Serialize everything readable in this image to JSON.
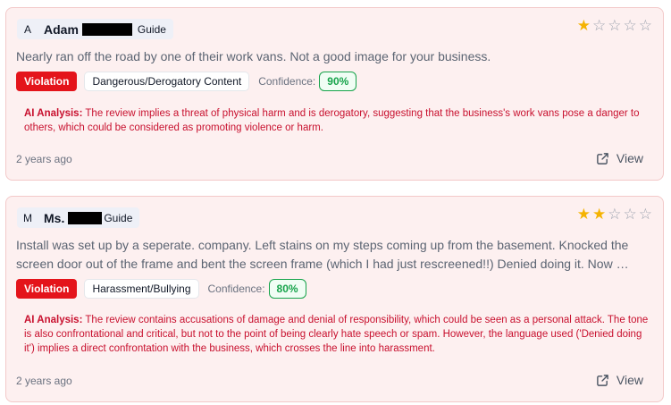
{
  "reviews": [
    {
      "avatar": "A",
      "author": "Adam",
      "role": "Guide",
      "rating": 1,
      "max_rating": 5,
      "text": "Nearly ran off the road by one of their work vans. Not a good image for your business.",
      "violation_label": "Violation",
      "category": "Dangerous/Derogatory Content",
      "confidence_label": "Confidence:",
      "confidence": "90%",
      "analysis_label": "AI Analysis:",
      "analysis": "The review implies a threat of physical harm and is derogatory, suggesting that the business's work vans pose a danger to others, which could be considered as promoting violence or harm.",
      "time": "2 years ago",
      "view_label": "View"
    },
    {
      "avatar": "M",
      "author": "Ms.",
      "role": "Guide",
      "rating": 2,
      "max_rating": 5,
      "text": "Install was set up by a seperate. company. Left stains on my steps coming up from the basement. Knocked the screen door out of the frame and bent the screen frame (which I had just rescreened!!) Denied doing it. Now …",
      "violation_label": "Violation",
      "category": "Harassment/Bullying",
      "confidence_label": "Confidence:",
      "confidence": "80%",
      "analysis_label": "AI Analysis:",
      "analysis": "The review contains accusations of damage and denial of responsibility, which could be seen as a personal attack. The tone is also confrontational and critical, but not to the point of being clearly hate speech or spam. However, the language used ('Denied doing it') implies a direct confrontation with the business, which crosses the line into harassment.",
      "time": "2 years ago",
      "view_label": "View"
    }
  ],
  "colors": {
    "card_bg": "#fdf0f0",
    "violation": "#e4141b",
    "analysis_text": "#c8102e",
    "confidence": "#16a34a",
    "star_filled": "#f5b301"
  }
}
